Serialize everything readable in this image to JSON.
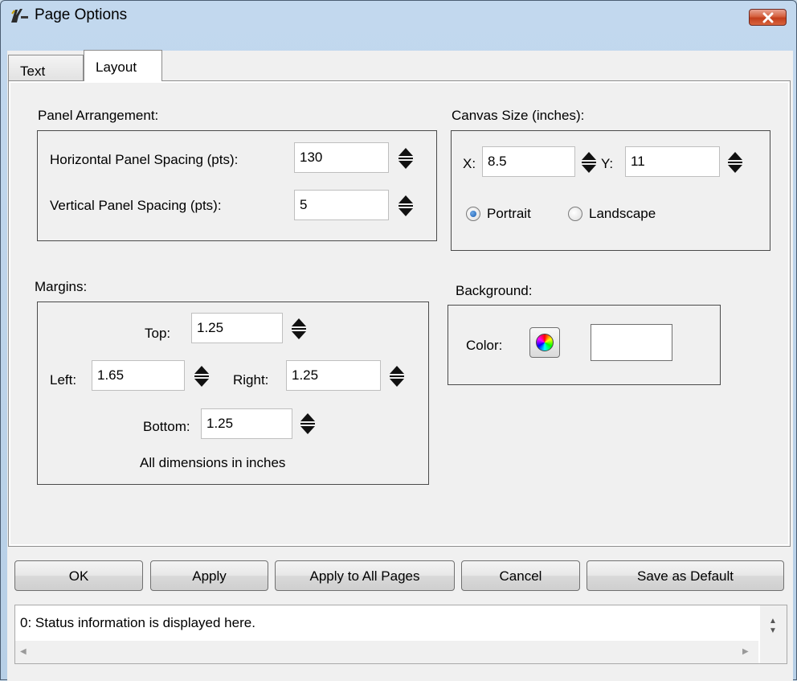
{
  "window": {
    "title": "Page Options"
  },
  "tabs": [
    {
      "label": "Text",
      "active": false
    },
    {
      "label": "Layout",
      "active": true
    }
  ],
  "panel_arrangement": {
    "label": "Panel Arrangement:",
    "horizontal_label": "Horizontal Panel Spacing (pts):",
    "horizontal_value": "130",
    "vertical_label": "Vertical Panel Spacing (pts):",
    "vertical_value": "5"
  },
  "canvas_size": {
    "label": "Canvas Size (inches):",
    "x_label": "X:",
    "x_value": "8.5",
    "y_label": "Y:",
    "y_value": "11",
    "orientation_options": [
      "Portrait",
      "Landscape"
    ],
    "orientation_selected": "Portrait"
  },
  "margins": {
    "label": "Margins:",
    "top_label": "Top:",
    "top_value": "1.25",
    "left_label": "Left:",
    "left_value": "1.65",
    "right_label": "Right:",
    "right_value": "1.25",
    "bottom_label": "Bottom:",
    "bottom_value": "1.25",
    "note": "All dimensions in inches"
  },
  "background": {
    "label": "Background:",
    "color_label": "Color:",
    "color_value": "#ffffff",
    "color_button_icon": "color-wheel-icon"
  },
  "buttons": {
    "ok": "OK",
    "apply": "Apply",
    "apply_all": "Apply to All Pages",
    "cancel": "Cancel",
    "save_default": "Save as Default"
  },
  "status": {
    "text": "0: Status information is displayed here."
  },
  "colors": {
    "titlebar": "#c2d8ee",
    "close_button": "#c23e1c",
    "radio_selected": "#1a5fb4",
    "client_bg": "#f0f0f0"
  }
}
